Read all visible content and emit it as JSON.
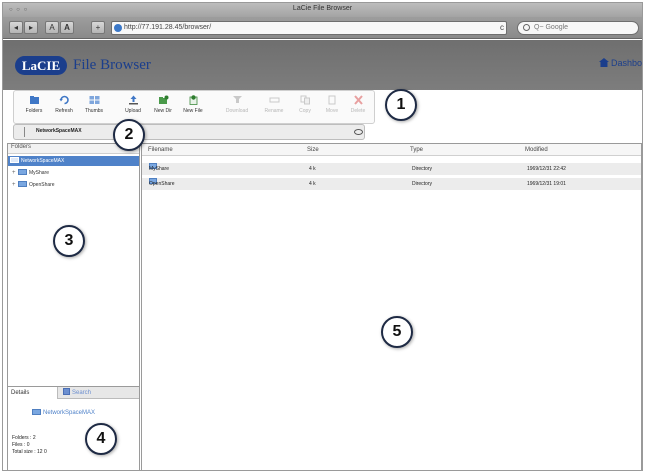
{
  "window": {
    "title": "LaCie File Browser",
    "traffic": "○ ○ ○"
  },
  "browser": {
    "back": "◂",
    "forward": "▸",
    "text_small": "A",
    "text_large": "A",
    "add": "+",
    "url": "http://77.191.28.45/browser/",
    "search_placeholder": "Q~ Google",
    "reload": "c"
  },
  "header": {
    "logo": "LaCIE",
    "app_title": "File Browser",
    "home_link": "Dashbo"
  },
  "toolbar": {
    "buttons": [
      {
        "label": "Folders",
        "icon": "folders-icon"
      },
      {
        "label": "Refresh",
        "icon": "refresh-icon"
      },
      {
        "label": "Thumbs",
        "icon": "thumbs-icon"
      },
      {
        "label": "Upload",
        "icon": "upload-icon"
      },
      {
        "label": "New Dir",
        "icon": "new-dir-icon"
      },
      {
        "label": "New File",
        "icon": "new-file-icon"
      },
      {
        "label": "Download",
        "icon": "download-icon"
      },
      {
        "label": "Rename",
        "icon": "rename-icon"
      },
      {
        "label": "Copy",
        "icon": "copy-icon"
      },
      {
        "label": "Move",
        "icon": "move-icon"
      },
      {
        "label": "Delete",
        "icon": "delete-icon"
      }
    ]
  },
  "breadcrumb": {
    "path": "NetworkSpaceMAX"
  },
  "folders": {
    "header": "Folders",
    "items": [
      {
        "label": "NetworkSpaceMAX",
        "selected": true
      },
      {
        "label": "MyShare"
      },
      {
        "label": "OpenShare"
      }
    ]
  },
  "details": {
    "tab_details": "Details",
    "tab_search": "Search",
    "name": "NetworkSpaceMAX",
    "folders_line": "Folders : 2",
    "files_line": "Files : 0",
    "size_line": "Total size : 12 0"
  },
  "filelist": {
    "columns": {
      "name": "Filename",
      "size": "Size",
      "type": "Type",
      "modified": "Modified"
    },
    "rows": [
      {
        "name": "MyShare",
        "size": "4 k",
        "type": "Directory",
        "modified": "1969/12/31 22:42"
      },
      {
        "name": "OpenShare",
        "size": "4 k",
        "type": "Directory",
        "modified": "1969/12/31 19:01"
      }
    ]
  },
  "callouts": [
    "1",
    "2",
    "3",
    "4",
    "5"
  ],
  "colors": {
    "brand_blue": "#1b3e8c",
    "selection": "#4f82c9",
    "header_gray": "#757575"
  }
}
